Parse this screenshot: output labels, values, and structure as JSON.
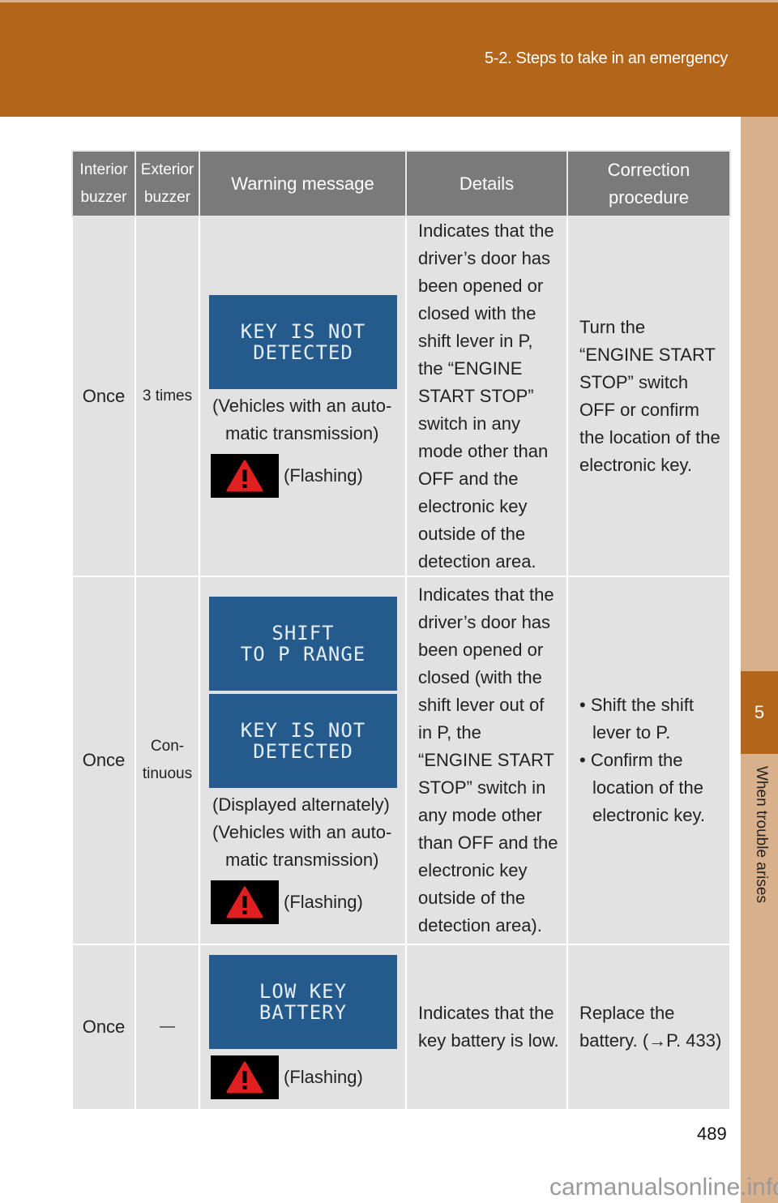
{
  "header": {
    "title": "5-2. Steps to take in an emergency"
  },
  "side": {
    "chapter": "5",
    "label": "When trouble arises"
  },
  "table": {
    "headers": [
      "Interior buzzer",
      "Exterior buzzer",
      "Warning message",
      "Details",
      "Correction procedure"
    ],
    "rows": [
      {
        "interior": "Once",
        "exterior": "3 times",
        "displays": [
          "KEY IS NOT\nDETECTED"
        ],
        "notes": [
          "(Vehicles with an auto-",
          "matic transmission)"
        ],
        "flash": "(Flashing)",
        "details": "Indicates that the driver’s door has been opened or closed with the shift lever in P, the “ENGINE START STOP” switch in any mode other than OFF and the electronic key outside of the detection area.",
        "correction": "Turn the “ENGINE START STOP” switch OFF or confirm the location of the electronic key."
      },
      {
        "interior": "Once",
        "exterior": "Con-tinuous",
        "displays": [
          "SHIFT\nTO P RANGE",
          "KEY IS NOT\nDETECTED"
        ],
        "notes": [
          "(Displayed alternately)",
          "(Vehicles with an auto-",
          "matic transmission)"
        ],
        "flash": "(Flashing)",
        "details": "Indicates that the driver’s door has been opened or closed (with the shift lever out of in P, the “ENGINE START STOP” switch in any mode other than OFF and the electronic key outside of the detection area).",
        "correction_list": [
          "• Shift the shift lever to P.",
          "• Confirm the location of the electronic key."
        ]
      },
      {
        "interior": "Once",
        "exterior": "—",
        "displays": [
          "LOW KEY\nBATTERY"
        ],
        "notes": [],
        "flash": "(Flashing)",
        "details": "Indicates that the key battery is low.",
        "correction": "Replace the battery. (→P. 433)"
      }
    ]
  },
  "footer": {
    "page": "489",
    "watermark": "carmanualsonline.info"
  }
}
